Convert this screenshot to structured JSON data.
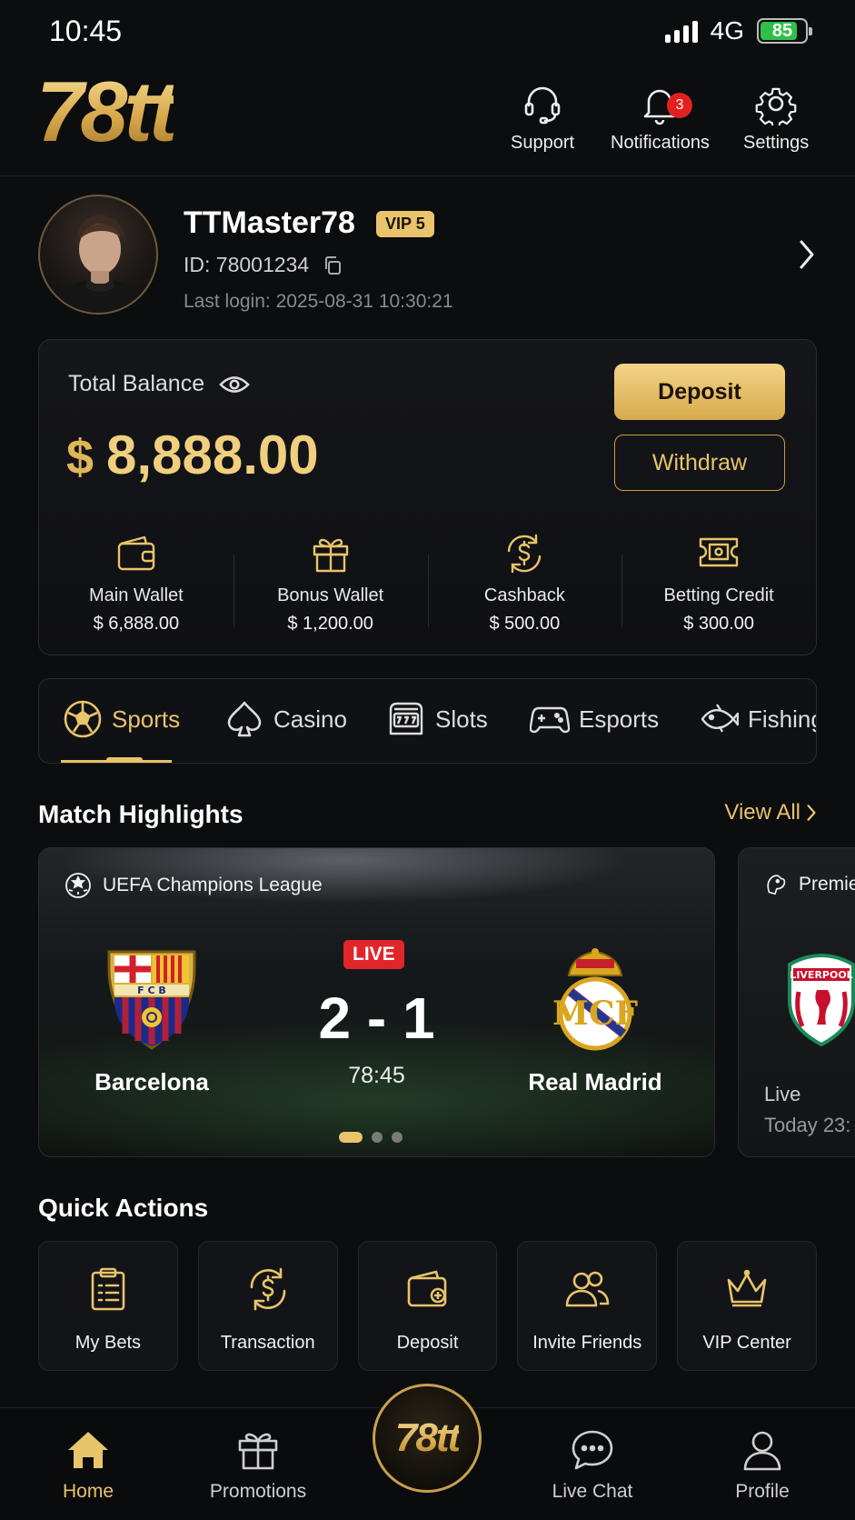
{
  "status_bar": {
    "time": "10:45",
    "network": "4G",
    "battery": "85"
  },
  "header": {
    "logo": "78tt",
    "support_label": "Support",
    "notifications_label": "Notifications",
    "notifications_count": "3",
    "settings_label": "Settings"
  },
  "profile": {
    "username": "TTMaster78",
    "vip": "VIP 5",
    "id": "ID: 78001234",
    "last_login": "Last login: 2025-08-31 10:30:21"
  },
  "balance": {
    "label": "Total Balance",
    "currency": "$",
    "amount": "8,888.00",
    "deposit_label": "Deposit",
    "withdraw_label": "Withdraw",
    "wallets": [
      {
        "name": "Main Wallet",
        "value": "$ 6,888.00",
        "icon": "wallet-icon"
      },
      {
        "name": "Bonus Wallet",
        "value": "$ 1,200.00",
        "icon": "gift-icon"
      },
      {
        "name": "Cashback",
        "value": "$ 500.00",
        "icon": "cashback-icon"
      },
      {
        "name": "Betting Credit",
        "value": "$ 300.00",
        "icon": "ticket-icon"
      }
    ]
  },
  "categories": [
    {
      "label": "Sports",
      "icon": "soccer-ball-icon",
      "active": true
    },
    {
      "label": "Casino",
      "icon": "spade-icon"
    },
    {
      "label": "Slots",
      "icon": "slot-machine-icon"
    },
    {
      "label": "Esports",
      "icon": "gamepad-icon"
    },
    {
      "label": "Fishing",
      "icon": "fish-icon"
    }
  ],
  "highlights": {
    "title": "Match Highlights",
    "view_all": "View All",
    "match": {
      "league": "UEFA Champions League",
      "home": "Barcelona",
      "away": "Real Madrid",
      "live": "LIVE",
      "score": "2 - 1",
      "time": "78:45"
    },
    "next_match": {
      "league": "Premie",
      "status": "Live",
      "time": "Today 23:"
    }
  },
  "quick_actions": {
    "title": "Quick Actions",
    "items": [
      {
        "label": "My Bets",
        "icon": "clipboard-icon"
      },
      {
        "label": "Transaction",
        "icon": "transaction-icon"
      },
      {
        "label": "Deposit",
        "icon": "wallet-add-icon"
      },
      {
        "label": "Invite Friends",
        "icon": "users-icon"
      },
      {
        "label": "VIP Center",
        "icon": "crown-icon"
      }
    ]
  },
  "bottom_nav": {
    "home": "Home",
    "promotions": "Promotions",
    "center_logo": "78tt",
    "live_chat": "Live Chat",
    "profile": "Profile"
  },
  "colors": {
    "accent": "#e8c46a",
    "background": "#0c0d0f",
    "live": "#e0262a",
    "badge": "#e3201d"
  }
}
